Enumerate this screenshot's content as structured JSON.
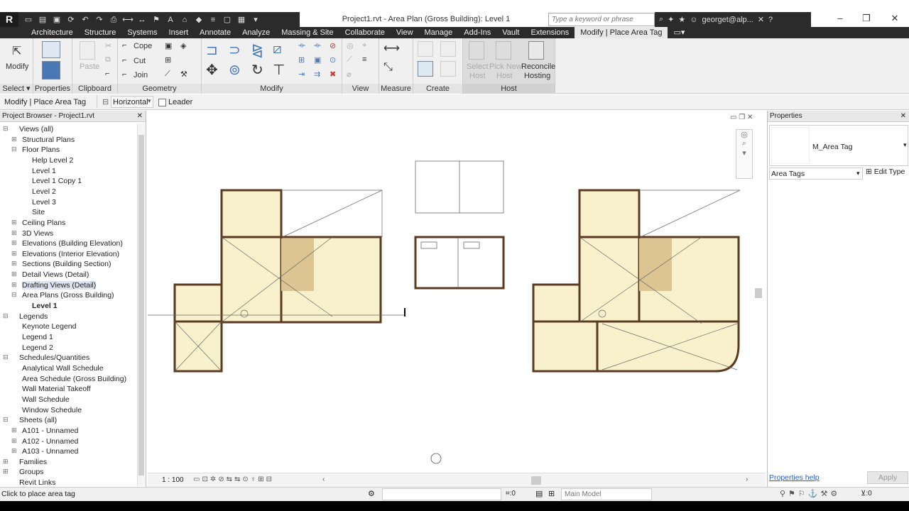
{
  "title": "Project1.rvt - Area Plan (Gross Building): Level 1",
  "search_placeholder": "Type a keyword or phrase",
  "user": "georget@alp...",
  "menus": [
    "Architecture",
    "Structure",
    "Systems",
    "Insert",
    "Annotate",
    "Analyze",
    "Massing & Site",
    "Collaborate",
    "View",
    "Manage",
    "Add-Ins",
    "Vault",
    "Extensions",
    "Modify | Place Area Tag"
  ],
  "ribbon": {
    "select_label": "Select",
    "properties_label": "Properties",
    "clipboard_label": "Clipboard",
    "geometry_label": "Geometry",
    "modify_panel_label": "Modify",
    "view_label": "View",
    "measure_label": "Measure",
    "create_label": "Create",
    "host_label": "Host",
    "modify_btn": "Modify",
    "paste_btn": "Paste",
    "cope_btn": "Cope",
    "cut_btn": "Cut",
    "join_btn": "Join",
    "select_host_1": "Select",
    "select_host_2": "Host",
    "pick_new_host_1": "Pick New",
    "pick_new_host_2": "Host",
    "reconcile_1": "Reconcile",
    "reconcile_2": "Hosting"
  },
  "options_bar": {
    "context": "Modify | Place Area Tag",
    "orientation": "Horizontal",
    "leader_label": "Leader"
  },
  "browser": {
    "title": "Project Browser - Project1.rvt",
    "items": [
      {
        "label": "Views (all)",
        "level": 0,
        "exp": "⊟"
      },
      {
        "label": "Structural Plans",
        "level": 1,
        "exp": "⊞"
      },
      {
        "label": "Floor Plans",
        "level": 1,
        "exp": "⊟"
      },
      {
        "label": "Help Level 2",
        "level": 2,
        "exp": ""
      },
      {
        "label": "Level 1",
        "level": 2,
        "exp": ""
      },
      {
        "label": "Level 1 Copy 1",
        "level": 2,
        "exp": ""
      },
      {
        "label": "Level 2",
        "level": 2,
        "exp": ""
      },
      {
        "label": "Level 3",
        "level": 2,
        "exp": ""
      },
      {
        "label": "Site",
        "level": 2,
        "exp": ""
      },
      {
        "label": "Ceiling Plans",
        "level": 1,
        "exp": "⊞"
      },
      {
        "label": "3D Views",
        "level": 1,
        "exp": "⊞"
      },
      {
        "label": "Elevations (Building Elevation)",
        "level": 1,
        "exp": "⊞"
      },
      {
        "label": "Elevations (Interior Elevation)",
        "level": 1,
        "exp": "⊞"
      },
      {
        "label": "Sections (Building Section)",
        "level": 1,
        "exp": "⊞"
      },
      {
        "label": "Detail Views (Detail)",
        "level": 1,
        "exp": "⊞"
      },
      {
        "label": "Drafting Views (Detail)",
        "level": 1,
        "exp": "⊞"
      },
      {
        "label": "Area Plans (Gross Building)",
        "level": 1,
        "exp": "⊟"
      },
      {
        "label": "Level 1",
        "level": 2,
        "exp": "",
        "bold": true
      },
      {
        "label": "Legends",
        "level": 0,
        "exp": "⊟"
      },
      {
        "label": "Keynote Legend",
        "level": 1,
        "exp": ""
      },
      {
        "label": "Legend 1",
        "level": 1,
        "exp": ""
      },
      {
        "label": "Legend 2",
        "level": 1,
        "exp": ""
      },
      {
        "label": "Schedules/Quantities",
        "level": 0,
        "exp": "⊟"
      },
      {
        "label": "Analytical Wall Schedule",
        "level": 1,
        "exp": ""
      },
      {
        "label": "Area Schedule (Gross Building)",
        "level": 1,
        "exp": ""
      },
      {
        "label": "Wall Material Takeoff",
        "level": 1,
        "exp": ""
      },
      {
        "label": "Wall Schedule",
        "level": 1,
        "exp": ""
      },
      {
        "label": "Window Schedule",
        "level": 1,
        "exp": ""
      },
      {
        "label": "Sheets (all)",
        "level": 0,
        "exp": "⊟"
      },
      {
        "label": "A101 - Unnamed",
        "level": 1,
        "exp": "⊞"
      },
      {
        "label": "A102 - Unnamed",
        "level": 1,
        "exp": "⊞"
      },
      {
        "label": "A103 - Unnamed",
        "level": 1,
        "exp": "⊞"
      },
      {
        "label": "Families",
        "level": 0,
        "exp": "⊞"
      },
      {
        "label": "Groups",
        "level": 0,
        "exp": "⊞"
      },
      {
        "label": "Revit Links",
        "level": 0,
        "exp": ""
      }
    ]
  },
  "canvas": {
    "scale": "1 : 100"
  },
  "properties": {
    "title": "Properties",
    "type_name": "M_Area Tag",
    "category": "Area Tags",
    "edit_type": "Edit Type",
    "help": "Properties help",
    "apply": "Apply"
  },
  "status": {
    "message": "Click to place area tag",
    "selection_count": ":0",
    "model": "Main Model",
    "filter_count": ":0"
  },
  "colors": {
    "wall": "#5a3a22",
    "room_fill": "#f9f1cc",
    "accent_fill": "#dcc592"
  }
}
